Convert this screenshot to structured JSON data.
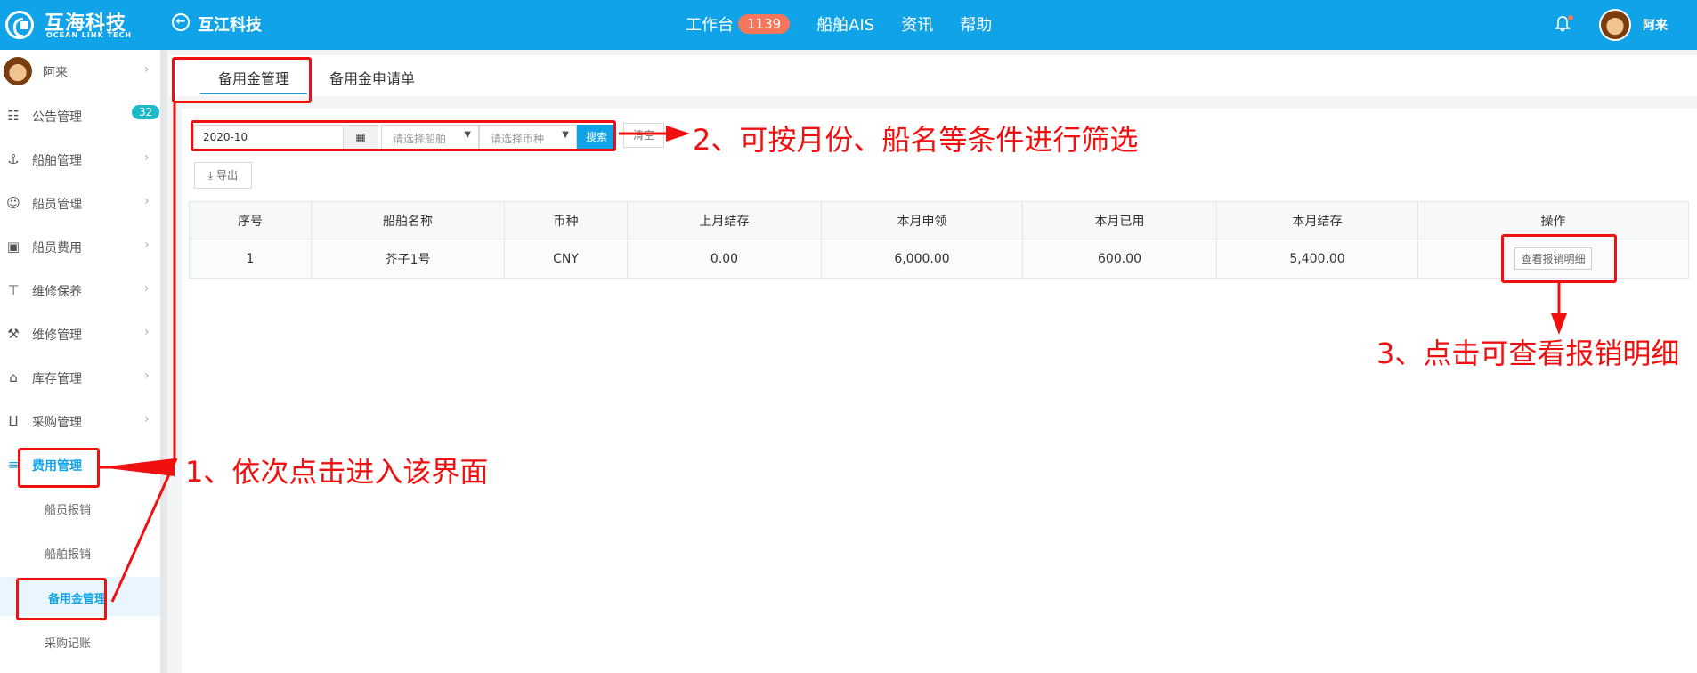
{
  "header": {
    "logo_cn": "互海科技",
    "logo_en": "OCEAN LINK TECH",
    "company": "互江科技",
    "nav": [
      {
        "label": "工作台",
        "badge": "1139"
      },
      {
        "label": "船舶AIS"
      },
      {
        "label": "资讯"
      },
      {
        "label": "帮助"
      }
    ],
    "user": "阿来"
  },
  "sidebar": {
    "user": "阿来",
    "items": [
      {
        "label": "公告管理",
        "icon": "book-icon",
        "badge": "32"
      },
      {
        "label": "船舶管理",
        "icon": "anchor-icon"
      },
      {
        "label": "船员管理",
        "icon": "person-icon"
      },
      {
        "label": "船员费用",
        "icon": "wallet-icon"
      },
      {
        "label": "维修保养",
        "icon": "hammer-icon"
      },
      {
        "label": "维修管理",
        "icon": "wrench-icon"
      },
      {
        "label": "库存管理",
        "icon": "home-icon"
      },
      {
        "label": "采购管理",
        "icon": "cart-icon"
      },
      {
        "label": "费用管理",
        "icon": "database-icon"
      }
    ],
    "sub_items": [
      {
        "label": "船员报销"
      },
      {
        "label": "船舶报销"
      },
      {
        "label": "备用金管理"
      },
      {
        "label": "采购记账"
      }
    ]
  },
  "tabs": [
    {
      "label": "备用金管理"
    },
    {
      "label": "备用金申请单"
    }
  ],
  "filters": {
    "month": "2020-10",
    "ship_placeholder": "请选择船舶",
    "currency_placeholder": "请选择币种",
    "search_label": "搜索",
    "clear_label": "清空",
    "export_label": "导出"
  },
  "table": {
    "headers": [
      "序号",
      "船舶名称",
      "币种",
      "上月结存",
      "本月申领",
      "本月已用",
      "本月结存",
      "操作"
    ],
    "rows": [
      {
        "no": "1",
        "ship": "芥子1号",
        "currency": "CNY",
        "last_balance": "0.00",
        "applied": "6,000.00",
        "used": "600.00",
        "balance": "5,400.00",
        "action": "查看报销明细"
      }
    ]
  },
  "annotations": {
    "step1": "1、依次点击进入该界面",
    "step2": "2、可按月份、船名等条件进行筛选",
    "step3": "3、点击可查看报销明细",
    "color": "#f01010"
  },
  "colors": {
    "primary": "#10a3e8",
    "badge": "#f6765b",
    "count_badge": "#1fb9c9"
  }
}
